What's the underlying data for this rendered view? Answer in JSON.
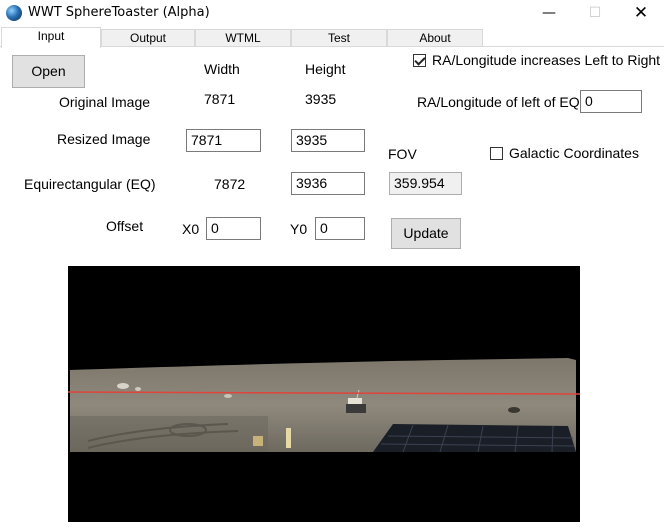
{
  "window": {
    "title": "WWT SphereToaster (Alpha)",
    "minimize_glyph": "—",
    "maximize_glyph": "☐",
    "close_glyph": "✕"
  },
  "tabs": [
    {
      "label": "Input",
      "active": true
    },
    {
      "label": "Output"
    },
    {
      "label": "WTML"
    },
    {
      "label": "Test"
    },
    {
      "label": "About"
    }
  ],
  "input_tab": {
    "open_label": "Open",
    "col_width": "Width",
    "col_height": "Height",
    "original_label": "Original Image",
    "original_width": "7871",
    "original_height": "3935",
    "resized_label": "Resized Image",
    "resized_width": "7871",
    "resized_height": "3935",
    "eq_label": "Equirectangular (EQ)",
    "eq_width": "7872",
    "eq_height": "3936",
    "offset_label": "Offset",
    "x0_label": "X0",
    "x0_value": "0",
    "y0_label": "Y0",
    "y0_value": "0",
    "fov_label": "FOV",
    "fov_value": "359.954",
    "update_label": "Update",
    "ra_checkbox_label": "RA/Longitude increases Left to Right",
    "ra_checkbox_checked": true,
    "ra_left_label": "RA/Longitude of left of EQ",
    "ra_left_value": "0",
    "galactic_label": "Galactic Coordinates",
    "galactic_checked": false
  },
  "colors": {
    "sky": "#000000",
    "ground": "#8a8478",
    "horizon_line": "#e0443a"
  }
}
